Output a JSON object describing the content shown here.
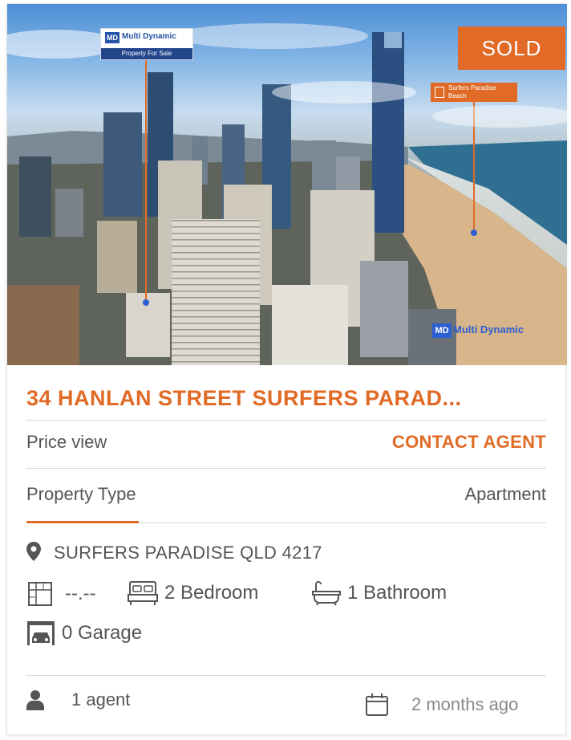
{
  "listing": {
    "status_badge": "SOLD",
    "photo": {
      "logo_name": "Multi Dynamic",
      "logo_mark": "MD",
      "logo_tagline": "Property For Sale",
      "beach_tag": "Surfers Paradise Beach",
      "watermark_mark": "MD",
      "watermark_name": "Multi Dynamic"
    },
    "title": "34 HANLAN STREET SURFERS PARAD...",
    "price": {
      "label": "Price view",
      "value": "CONTACT AGENT"
    },
    "property_type": {
      "label": "Property Type",
      "value": "Apartment"
    },
    "address": "SURFERS PARADISE QLD 4217",
    "features": {
      "area": "--.--",
      "bedrooms": "2 Bedroom",
      "bathrooms": "1 Bathroom",
      "garage": "0 Garage"
    },
    "footer": {
      "agents": "1 agent",
      "listed": "2 months ago"
    }
  },
  "colors": {
    "accent": "#e06a26",
    "text": "#555555",
    "divider": "#d6d6d6"
  },
  "icons": [
    "location-pin-icon",
    "floor-area-icon",
    "bed-icon",
    "bathtub-icon",
    "garage-icon",
    "user-icon",
    "calendar-icon"
  ]
}
